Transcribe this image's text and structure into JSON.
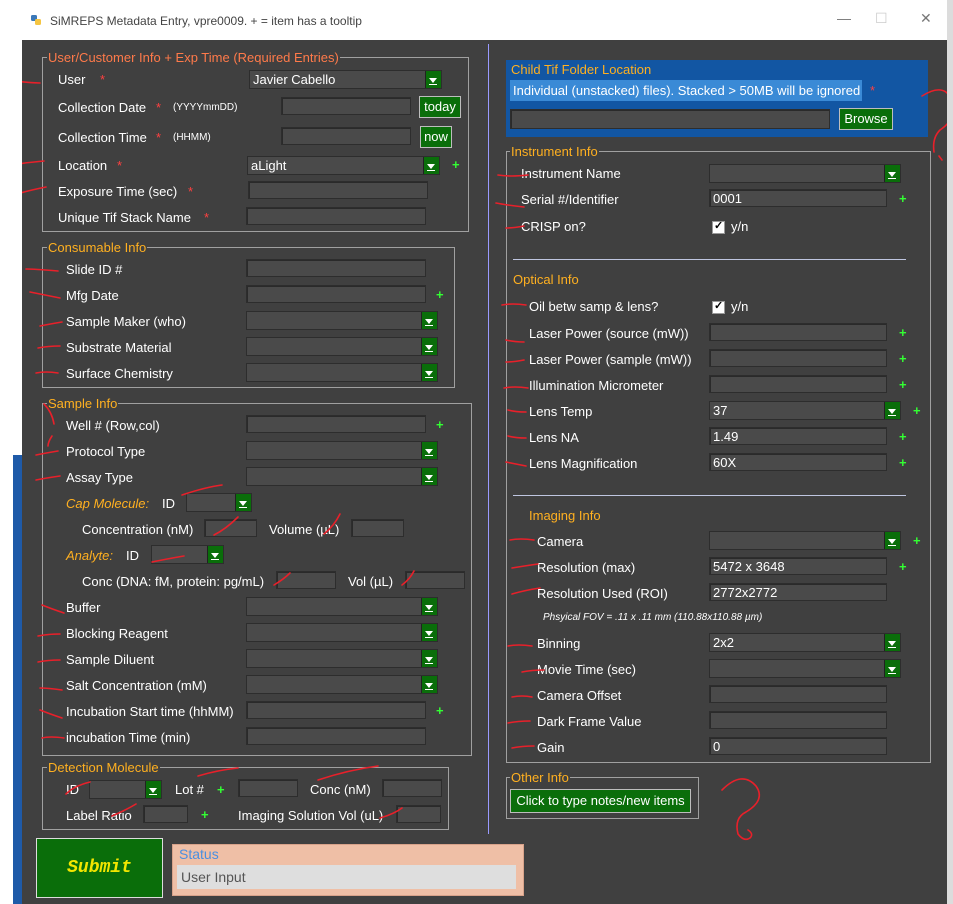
{
  "window": {
    "title": "SiMREPS Metadata Entry, vpre0009.   + = item has a tooltip",
    "minimize": "—",
    "maximize": "☐",
    "close": "✕"
  },
  "user_section": {
    "title": "User/Customer Info + Exp Time (Required Entries)",
    "user_label": "User",
    "user_value": "Javier Cabello",
    "collection_date_label": "Collection Date",
    "date_format": "(YYYYmmDD)",
    "today_button": "today",
    "collection_time_label": "Collection Time",
    "time_format": "(HHMM)",
    "now_button": "now",
    "location_label": "Location",
    "location_value": "aLight",
    "exposure_label": "Exposure Time (sec)",
    "stack_name_label": "Unique Tif Stack Name"
  },
  "consumable": {
    "title": "Consumable Info",
    "slide_id": "Slide ID #",
    "mfg_date": "Mfg Date",
    "sample_maker": "Sample Maker (who)",
    "substrate": "Substrate Material",
    "surface": "Surface Chemistry"
  },
  "sample": {
    "title": "Sample Info",
    "well": "Well # (Row,col)",
    "protocol": "Protocol Type",
    "assay": "Assay Type",
    "cap_molecule": "Cap Molecule:",
    "id_label": "ID",
    "concentration": "Concentration (nM)",
    "volume": "Volume (µL)",
    "analyte": "Analyte:",
    "conc_dna": "Conc (DNA: fM, protein: pg/mL)",
    "vol": "Vol (µL)",
    "buffer": "Buffer",
    "blocking": "Blocking Reagent",
    "diluent": "Sample Diluent",
    "salt": "Salt Concentration (mM)",
    "incub_start": "Incubation Start time (hhMM)",
    "incub_time": "incubation Time (min)"
  },
  "detection": {
    "title": "Detection Molecule",
    "id_label": "ID",
    "lot": "Lot #",
    "conc": "Conc (nM)",
    "label_ratio": "Label Ratio",
    "imaging_vol": "Imaging Solution Vol (uL)"
  },
  "submit": {
    "label": "Submit"
  },
  "status": {
    "title": "Status",
    "value": "User Input"
  },
  "child_tif": {
    "title": "Child Tif Folder Location",
    "hint": "Individual (unstacked) files). Stacked > 50MB will be ignored",
    "browse": "Browse"
  },
  "instrument": {
    "title": "Instrument Info",
    "name_label": "Instrument Name",
    "serial_label": "Serial #/Identifier",
    "serial_value": "0001",
    "crisp_label": "CRISP on?",
    "crisp_check": "y/n"
  },
  "optical": {
    "title": "Optical Info",
    "oil_label": "Oil betw samp & lens?",
    "oil_check": "y/n",
    "laser_source": "Laser Power (source (mW))",
    "laser_sample": "Laser Power (sample (mW))",
    "illum": "Illumination Micrometer",
    "lens_temp": "Lens Temp",
    "lens_temp_value": "37",
    "lens_na": "Lens NA",
    "lens_na_value": "1.49",
    "lens_mag": "Lens Magnification",
    "lens_mag_value": "60X"
  },
  "imaging": {
    "title": "Imaging Info",
    "camera": "Camera",
    "res_max": "Resolution (max)",
    "res_max_value": "5472 x 3648",
    "res_used": "Resolution Used (ROI)",
    "res_used_value": "2772x2772",
    "fov": "Phsyical FOV = .11 x .11 mm (110.88x110.88 µm)",
    "binning": "Binning",
    "binning_value": "2x2",
    "movie_time": "Movie Time (sec)",
    "camera_offset": "Camera Offset",
    "dark_frame": "Dark Frame Value",
    "gain": "Gain",
    "gain_value": "0"
  },
  "other": {
    "title": "Other Info",
    "notes_button": "Click to type notes/new items"
  },
  "symbols": {
    "required": "*",
    "tooltip": "+"
  },
  "colors": {
    "window_bg": "#404040",
    "accent_green": "#0a6e0a",
    "section_title": "#ffb020",
    "required": "#ff4040",
    "tooltip_plus": "#33ff33"
  }
}
